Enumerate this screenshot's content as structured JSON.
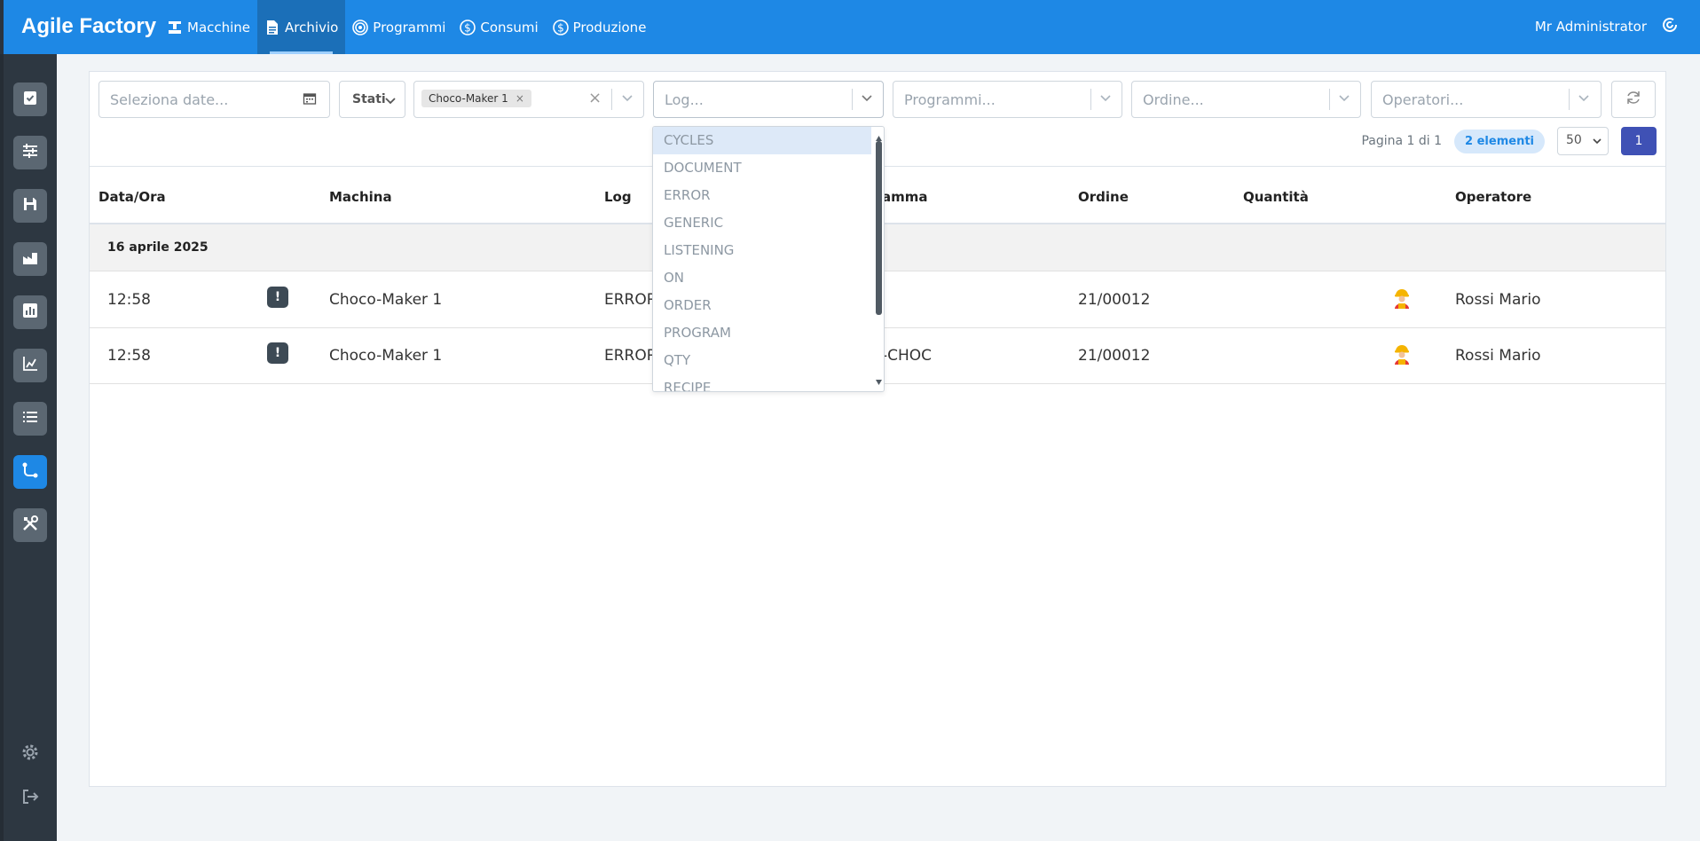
{
  "app": {
    "title": "Agile Factory",
    "user": "Mr Administrator"
  },
  "nav": [
    {
      "label": "Macchine",
      "icon": "machine-icon"
    },
    {
      "label": "Archivio",
      "icon": "archive-icon",
      "active": true
    },
    {
      "label": "Programmi",
      "icon": "target-icon"
    },
    {
      "label": "Consumi",
      "icon": "dollar-icon"
    },
    {
      "label": "Produzione",
      "icon": "dollar-icon"
    }
  ],
  "filters": {
    "date_placeholder": "Seleziona date...",
    "stati_label": "Stati",
    "machine_tag": "Choco-Maker 1",
    "log_placeholder": "Log...",
    "programs_placeholder": "Programmi...",
    "order_placeholder": "Ordine...",
    "operators_placeholder": "Operatori..."
  },
  "pager": {
    "info": "Pagina 1 di 1",
    "count": "2 elementi",
    "page_size": "50",
    "current_page": "1"
  },
  "table": {
    "headers": {
      "datetime": "Data/Ora",
      "machine": "Machina",
      "log": "Log",
      "program": "amma",
      "order": "Ordine",
      "quantity": "Quantità",
      "operator": "Operatore"
    },
    "group_label": "16 aprile 2025",
    "rows": [
      {
        "time": "12:58",
        "machine": "Choco-Maker 1",
        "log": "ERROR",
        "program": "",
        "order": "21/00012",
        "operator": "Rossi Mario"
      },
      {
        "time": "12:58",
        "machine": "Choco-Maker 1",
        "log": "ERROR",
        "program": "-CHOC",
        "order": "21/00012",
        "operator": "Rossi Mario"
      }
    ]
  },
  "log_options": [
    "CYCLES",
    "DOCUMENT",
    "ERROR",
    "GENERIC",
    "LISTENING",
    "ON",
    "ORDER",
    "PROGRAM",
    "QTY",
    "RECIPE"
  ],
  "colors": {
    "primary": "#1e88e5",
    "sidebar": "#2d3741",
    "accent": "#3f51b5"
  }
}
